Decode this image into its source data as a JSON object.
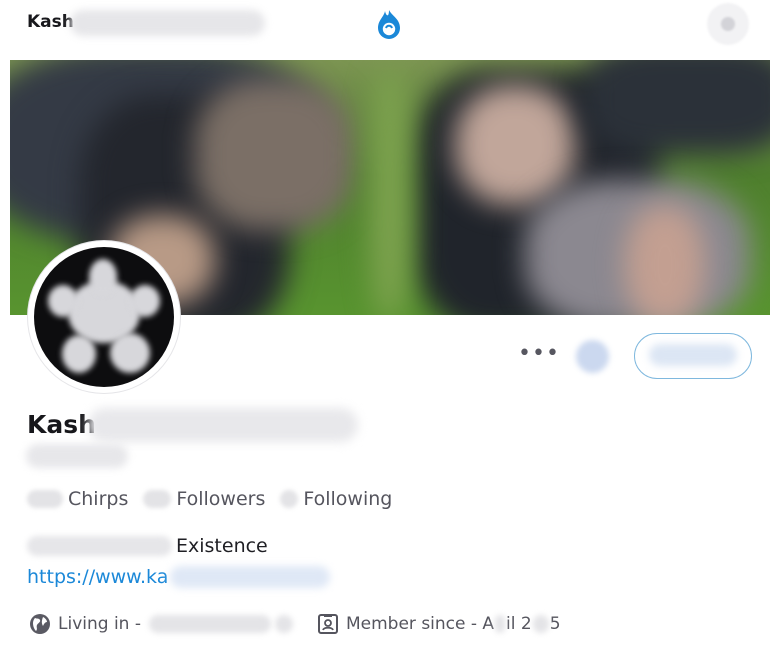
{
  "topbar": {
    "name_visible": "Kash",
    "logo_icon": "app-flame-logo",
    "action_icon": "settings-icon"
  },
  "profile": {
    "name_visible": "Kash",
    "more_label": "•••",
    "stats": [
      {
        "label": "Chirps"
      },
      {
        "label": "Followers"
      },
      {
        "label": "Following"
      }
    ],
    "bio_text": "Existence",
    "website_visible": "https://www.ka",
    "living_prefix": "Living in -",
    "member_prefix": "Member since - A",
    "member_fragment_1": "il 2",
    "member_fragment_2": "5"
  },
  "colors": {
    "accent": "#1b88d8",
    "button_border": "#7fb8de",
    "text_secondary": "#55555e"
  }
}
